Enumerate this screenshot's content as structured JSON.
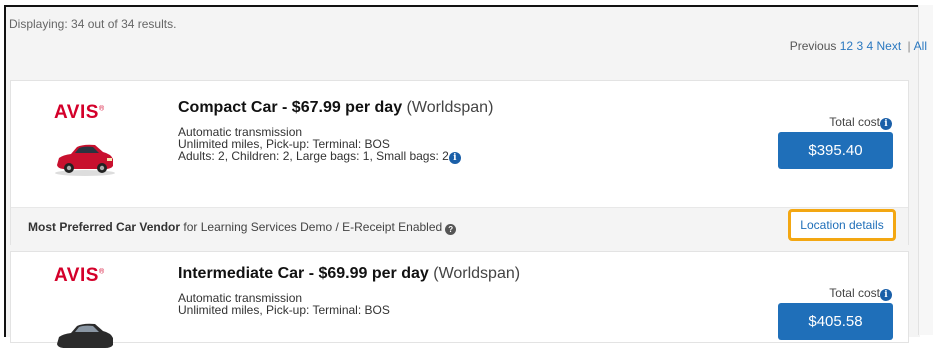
{
  "results": {
    "displaying_text": "Displaying: 34 out of 34 results.",
    "pager": {
      "previous": "Previous",
      "pages": [
        "1",
        "2",
        "3",
        "4"
      ],
      "next": "Next",
      "separator": "|",
      "all": "All"
    }
  },
  "cards": [
    {
      "vendor_logo": "AVIS",
      "title": "Compact Car - $67.99 per day",
      "gds": "(Worldspan)",
      "details": [
        "Automatic transmission",
        "Unlimited miles, Pick-up: Terminal: BOS",
        "Adults: 2, Children: 2, Large bags: 1, Small bags: 2"
      ],
      "total_label": "Total cost",
      "price": "$395.40",
      "car_color": "#c8102e",
      "preferred_label": "Most Preferred Car Vendor",
      "preferred_suffix": " for Learning Services Demo / E-Receipt Enabled",
      "location_button": "Location details"
    },
    {
      "vendor_logo": "AVIS",
      "title": "Intermediate Car - $69.99 per day",
      "gds": "(Worldspan)",
      "details": [
        "Automatic transmission",
        "Unlimited miles, Pick-up: Terminal: BOS"
      ],
      "total_label": "Total cost",
      "price": "$405.58",
      "car_color": "#2b2b2b"
    }
  ],
  "colors": {
    "accent": "#1f6fb9",
    "brand_red": "#d4002a",
    "highlight": "#f3a712"
  }
}
